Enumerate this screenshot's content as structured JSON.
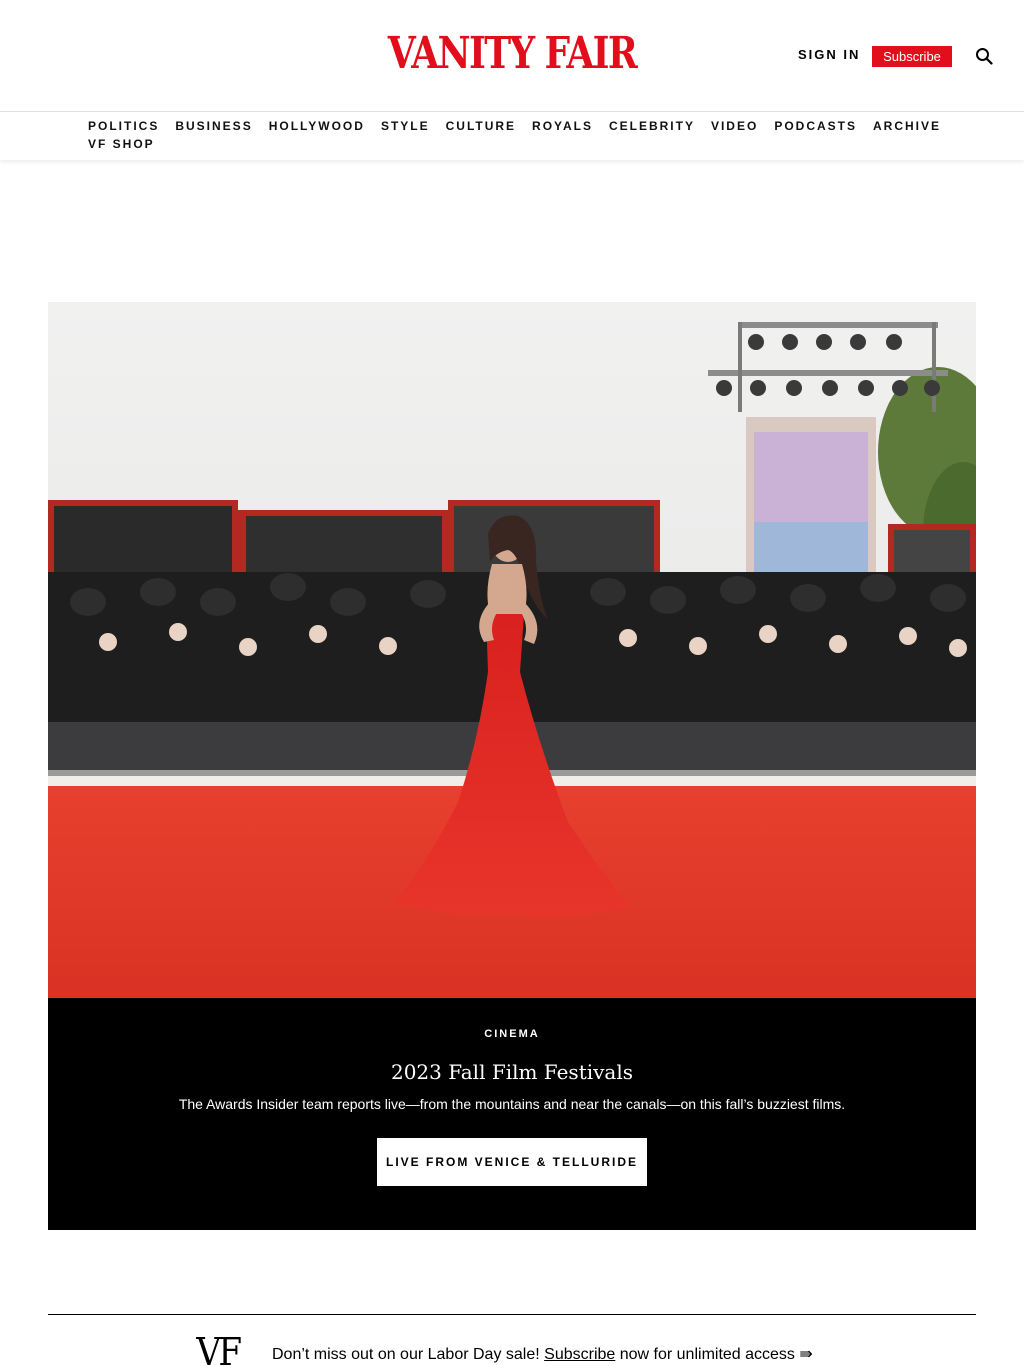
{
  "brand": {
    "logo_text": "VANITY FAIR",
    "accent_color": "#e30e1b"
  },
  "header": {
    "sign_in_label": "SIGN IN",
    "subscribe_label": "Subscribe",
    "search_icon": "search-icon"
  },
  "nav": {
    "items": [
      "POLITICS",
      "BUSINESS",
      "HOLLYWOOD",
      "STYLE",
      "CULTURE",
      "ROYALS",
      "CELEBRITY",
      "VIDEO",
      "PODCASTS",
      "ARCHIVE",
      "VF SHOP"
    ]
  },
  "hero": {
    "image_alt": "Woman in red gown on red carpet facing photographers",
    "kicker": "CINEMA",
    "headline": "2023 Fall Film Festivals",
    "dek": "The Awards Insider team reports live—from the mountains and near the canals—on this fall’s buzziest films.",
    "cta_label": "LIVE FROM VENICE & TELLURIDE"
  },
  "promo": {
    "mark": "VF",
    "text_before": "Don’t miss out on our Labor Day sale! ",
    "link_label": "Subscribe",
    "text_after": " now for unlimited access ⇛"
  }
}
